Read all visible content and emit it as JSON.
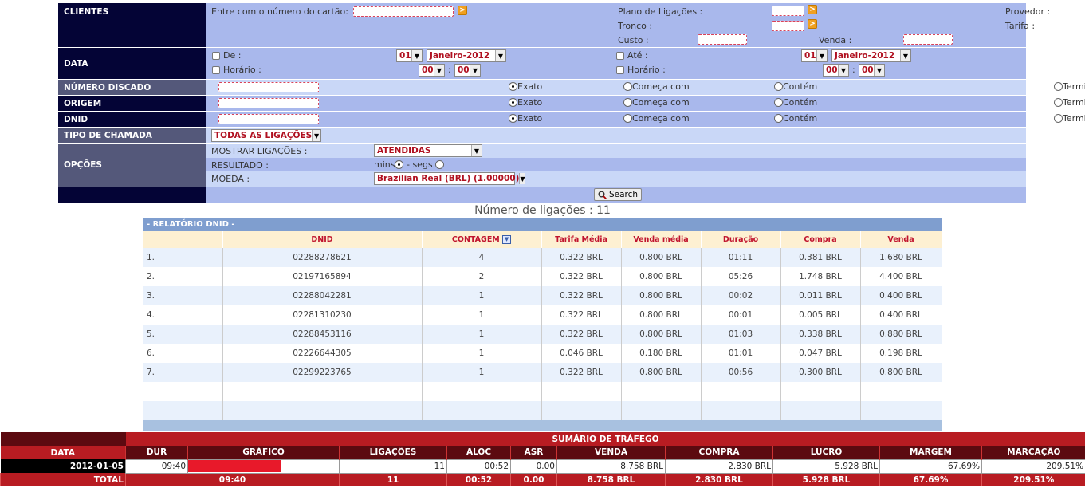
{
  "filters": {
    "clientes": {
      "label": "CLIENTES",
      "card_label": "Entre com o número do cartão:",
      "plano_label": "Plano de Ligações :",
      "provedor_label": "Provedor :",
      "tronco_label": "Tronco :",
      "tarifa_label": "Tarifa :",
      "custo_label": "Custo :",
      "venda_label": "Venda :",
      "go_glyph": ">"
    },
    "data": {
      "label": "DATA",
      "de_label": "De :",
      "ate_label": "Até :",
      "day_from": "01",
      "month_from": "Janeiro-2012",
      "day_to": "01",
      "month_to": "Janeiro-2012",
      "horario_label": "Horário :",
      "hour_from": "00",
      "min_from": "00",
      "hour_to": "00",
      "min_to": "00",
      "colon": ":"
    },
    "numero_discado": {
      "label": "NÚMERO DISCADO"
    },
    "origem": {
      "label": "ORIGEM"
    },
    "dnid": {
      "label": "DNID"
    },
    "match_options": [
      "Exato",
      "Começa com",
      "Contém",
      "Termina com"
    ],
    "tipo_chamada": {
      "label": "TIPO DE CHAMADA",
      "value": "TODAS AS LIGAÇÕES"
    },
    "opcoes": {
      "label": "OPÇÕES",
      "mostrar_label": "MOSTRAR LIGAÇÕES :",
      "mostrar_value": "ATENDIDAS",
      "resultado_label": "RESULTADO :",
      "mins_label": "mins",
      "segs_label": " - segs",
      "moeda_label": "MOEDA :",
      "moeda_value": "Brazilian Real (BRL) (1.00000)"
    },
    "search_label": "Search"
  },
  "count_text": "Número de ligações : 11",
  "report": {
    "title": "- RELATÓRIO DNID -",
    "columns": [
      "DNID",
      "CONTAGEM",
      "Tarifa Média",
      "Venda média",
      "Duração",
      "Compra",
      "Venda"
    ],
    "rows": [
      {
        "n": "1.",
        "dnid": "02288278621",
        "contagem": "4",
        "tarifa": "0.322 BRL",
        "venda_media": "0.800 BRL",
        "duracao": "01:11",
        "compra": "0.381 BRL",
        "venda": "1.680 BRL"
      },
      {
        "n": "2.",
        "dnid": "02197165894",
        "contagem": "2",
        "tarifa": "0.322 BRL",
        "venda_media": "0.800 BRL",
        "duracao": "05:26",
        "compra": "1.748 BRL",
        "venda": "4.400 BRL"
      },
      {
        "n": "3.",
        "dnid": "02288042281",
        "contagem": "1",
        "tarifa": "0.322 BRL",
        "venda_media": "0.800 BRL",
        "duracao": "00:02",
        "compra": "0.011 BRL",
        "venda": "0.400 BRL"
      },
      {
        "n": "4.",
        "dnid": "02281310230",
        "contagem": "1",
        "tarifa": "0.322 BRL",
        "venda_media": "0.800 BRL",
        "duracao": "00:01",
        "compra": "0.005 BRL",
        "venda": "0.400 BRL"
      },
      {
        "n": "5.",
        "dnid": "02288453116",
        "contagem": "1",
        "tarifa": "0.322 BRL",
        "venda_media": "0.800 BRL",
        "duracao": "01:03",
        "compra": "0.338 BRL",
        "venda": "0.880 BRL"
      },
      {
        "n": "6.",
        "dnid": "02226644305",
        "contagem": "1",
        "tarifa": "0.046 BRL",
        "venda_media": "0.180 BRL",
        "duracao": "01:01",
        "compra": "0.047 BRL",
        "venda": "0.198 BRL"
      },
      {
        "n": "7.",
        "dnid": "02299223765",
        "contagem": "1",
        "tarifa": "0.322 BRL",
        "venda_media": "0.800 BRL",
        "duracao": "00:56",
        "compra": "0.300 BRL",
        "venda": "0.800 BRL"
      }
    ]
  },
  "summary": {
    "title": "SUMÁRIO DE TRÁFEGO",
    "columns": [
      "DATA",
      "DUR",
      "GRÁFICO",
      "LIGAÇÕES",
      "ALOC",
      "ASR",
      "VENDA",
      "COMPRA",
      "LUCRO",
      "MARGEM",
      "MARCAÇÃO"
    ],
    "row": {
      "data": "2012-01-05",
      "dur": "09:40",
      "graph_fraction": 1.0,
      "ligacoes": "11",
      "aloc": "00:52",
      "asr": "0.00",
      "venda": "8.758 BRL",
      "compra": "2.830 BRL",
      "lucro": "5.928 BRL",
      "margem": "67.69%",
      "marcacao": "209.51%"
    },
    "total": {
      "label": "TOTAL",
      "dur": "09:40",
      "ligacoes": "11",
      "aloc": "00:52",
      "asr": "0.00",
      "venda": "8.758 BRL",
      "compra": "2.830 BRL",
      "lucro": "5.928 BRL",
      "margem": "67.69%",
      "marcacao": "209.51%"
    }
  },
  "colors": {
    "nav_dark": "#040436",
    "filter_bg": "#a9b8ec",
    "accent_red": "#b81c22",
    "summary_dark": "#5c0a10"
  }
}
